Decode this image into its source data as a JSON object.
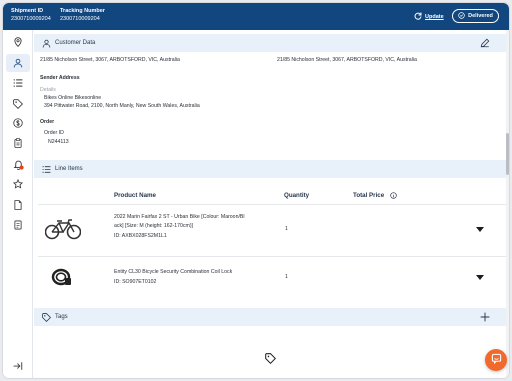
{
  "header": {
    "shipment_id_label": "Shipment ID",
    "shipment_id_value": "2300710009204",
    "tracking_label": "Tracking Number",
    "tracking_value": "2300710009204",
    "update_label": "Update",
    "status_label": "Delivered"
  },
  "sidebar": {
    "items": [
      "location-pin-icon",
      "user-icon",
      "list-icon",
      "tag-icon",
      "dollar-icon",
      "clipboard-icon",
      "bell-icon",
      "star-icon",
      "file-icon",
      "document-icon"
    ],
    "collapse_icon": "collapse-icon"
  },
  "customer": {
    "title": "Customer Data",
    "address_left": "21/85 Nicholson Street, 3067, ARBOTSFORD, VIC, Australia",
    "address_right": "21/85 Nicholson Street, 3067, ARBOTSFORD, VIC, Australia",
    "sender_heading": "Sender Address",
    "details_label": "Details",
    "sender_name": "Bikes Online Bikesonline",
    "sender_address": "394 Pittwater Road, 2100, North Manly, New South Wales, Australia",
    "order_heading": "Order",
    "order_id_label": "Order ID",
    "order_id_value": "N244113"
  },
  "line_items": {
    "title": "Line Items",
    "columns": {
      "product": "Product Name",
      "quantity": "Quantity",
      "total": "Total Price"
    },
    "rows": [
      {
        "name_line1": "2022 Marin Fairfax 2 ST - Urban Bike [Colour: Maroon/Bl",
        "name_line2": "ack] [Size: M (height: 162-170cm)]",
        "id": "ID: AXBX028FS2M1L1",
        "quantity": "1"
      },
      {
        "name_line1": "Entity CL30 Bicycle Security Combination Coil Lock",
        "name_line2": "",
        "id": "ID: SO907ET0102",
        "quantity": "1"
      }
    ]
  },
  "tags": {
    "title": "Tags"
  },
  "colors": {
    "header_bg": "#12467f",
    "section_bg": "#e8f0f9",
    "chat_button": "#ef6a2c"
  }
}
